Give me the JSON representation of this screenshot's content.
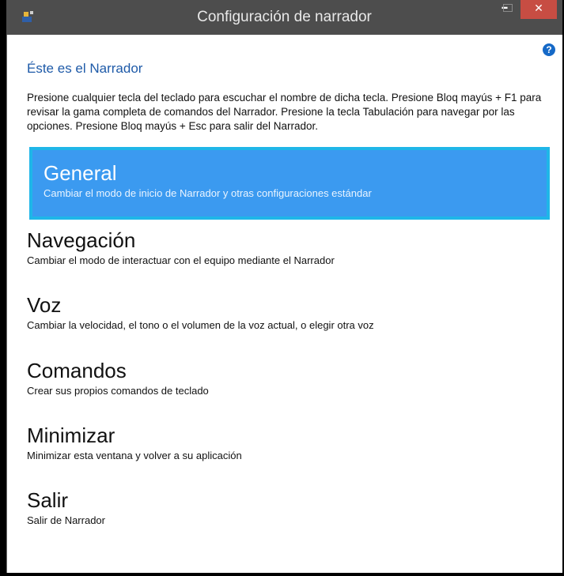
{
  "window": {
    "title": "Configuración de narrador",
    "min_glyph": "–",
    "close_glyph": "✕"
  },
  "help": {
    "glyph": "?"
  },
  "page": {
    "title": "Éste es el Narrador",
    "intro": "Presione cualquier tecla del teclado para escuchar el nombre de dicha tecla. Presione Bloq mayús + F1 para revisar la gama completa de comandos del Narrador. Presione la tecla Tabulación para navegar por las opciones. Presione Bloq mayús + Esc para salir del Narrador."
  },
  "options": [
    {
      "title": "General",
      "description": "Cambiar el modo de inicio de Narrador y otras configuraciones estándar",
      "selected": true
    },
    {
      "title": "Navegación",
      "description": "Cambiar el modo de interactuar con el equipo mediante el Narrador",
      "selected": false
    },
    {
      "title": "Voz",
      "description": "Cambiar la velocidad, el tono o el volumen de la voz actual, o elegir otra voz",
      "selected": false
    },
    {
      "title": "Comandos",
      "description": "Crear sus propios comandos de teclado",
      "selected": false
    },
    {
      "title": "Minimizar",
      "description": "Minimizar esta ventana y volver a su aplicación",
      "selected": false
    },
    {
      "title": "Salir",
      "description": "Salir de Narrador",
      "selected": false
    }
  ],
  "colors": {
    "titlebar": "#4d4d4d",
    "close": "#c74d43",
    "selected_bg": "#3b9af0",
    "selected_border": "#1fb6e8",
    "link": "#1e5aa8"
  }
}
